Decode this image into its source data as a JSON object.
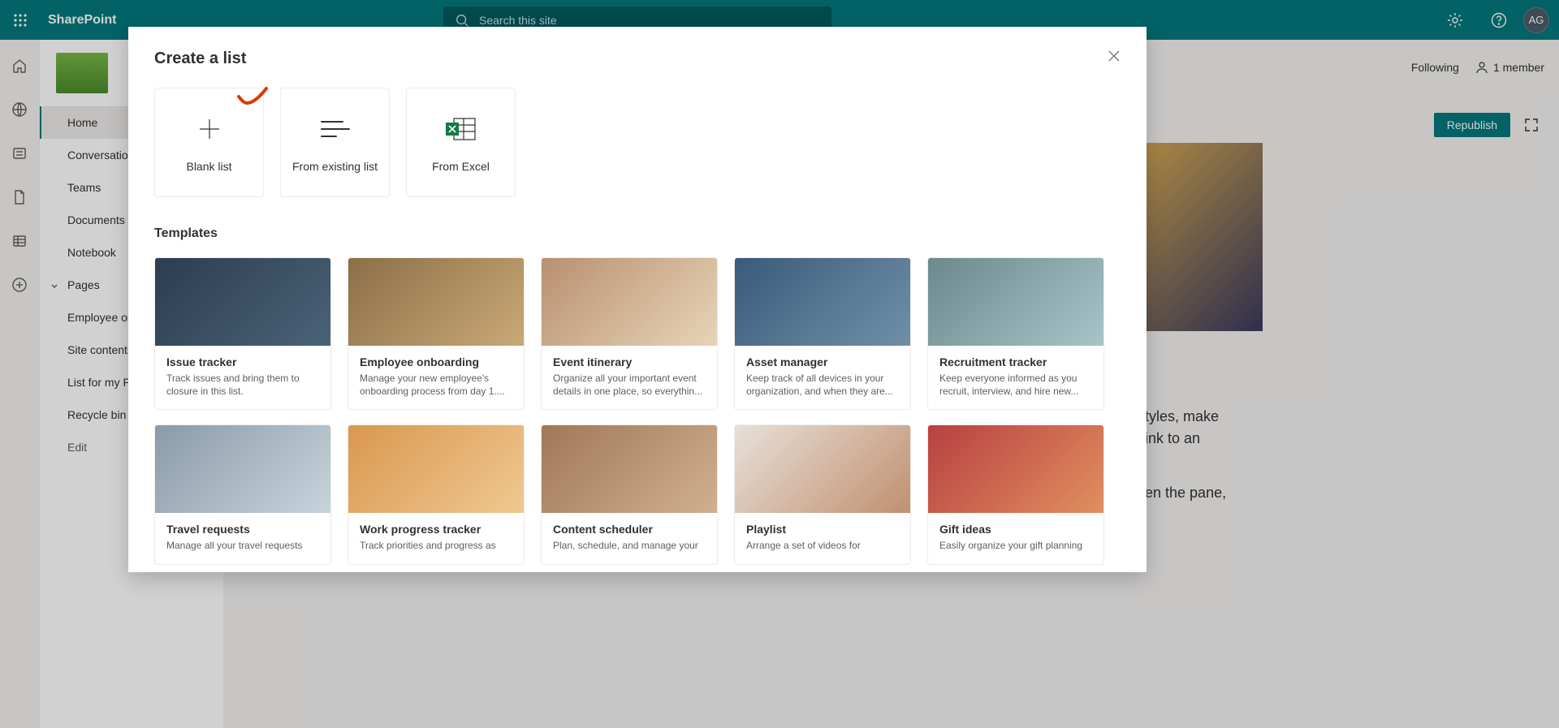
{
  "suite": {
    "app_name": "SharePoint",
    "search_placeholder": "Search this site",
    "avatar_initials": "AG"
  },
  "side_nav": {
    "items": [
      {
        "label": "Home",
        "active": true
      },
      {
        "label": "Conversations"
      },
      {
        "label": "Teams"
      },
      {
        "label": "Documents"
      },
      {
        "label": "Notebook"
      },
      {
        "label": "Pages",
        "expandable": true
      },
      {
        "label": "Employee onboarding"
      },
      {
        "label": "Site contents"
      },
      {
        "label": "List for my Project"
      },
      {
        "label": "Recycle bin"
      },
      {
        "label": "Edit",
        "edit": true
      }
    ]
  },
  "header_right": {
    "following_label": "Following",
    "members_label": "1 member",
    "republish_label": "Republish"
  },
  "bg_content": {
    "line1": "tyles, make",
    "line2": "ink to an",
    "line3": "en the pane,"
  },
  "modal": {
    "title": "Create a list",
    "create_options": [
      {
        "label": "Blank list",
        "key": "blank"
      },
      {
        "label": "From existing list",
        "key": "existing"
      },
      {
        "label": "From Excel",
        "key": "excel"
      }
    ],
    "templates_title": "Templates",
    "templates": [
      {
        "title": "Issue tracker",
        "desc": "Track issues and bring them to closure in this list.",
        "img": "img-issue"
      },
      {
        "title": "Employee onboarding",
        "desc": "Manage your new employee's onboarding process from day 1....",
        "img": "img-emp"
      },
      {
        "title": "Event itinerary",
        "desc": "Organize all your important event details in one place, so everythin...",
        "img": "img-event"
      },
      {
        "title": "Asset manager",
        "desc": "Keep track of all devices in your organization, and when they are...",
        "img": "img-asset"
      },
      {
        "title": "Recruitment tracker",
        "desc": "Keep everyone informed as you recruit, interview, and hire new...",
        "img": "img-recruit"
      },
      {
        "title": "Travel requests",
        "desc": "Manage all your travel requests",
        "img": "img-travel"
      },
      {
        "title": "Work progress tracker",
        "desc": "Track priorities and progress as",
        "img": "img-work"
      },
      {
        "title": "Content scheduler",
        "desc": "Plan, schedule, and manage your",
        "img": "img-content"
      },
      {
        "title": "Playlist",
        "desc": "Arrange a set of videos for",
        "img": "img-play"
      },
      {
        "title": "Gift ideas",
        "desc": "Easily organize your gift planning",
        "img": "img-gift"
      }
    ]
  }
}
